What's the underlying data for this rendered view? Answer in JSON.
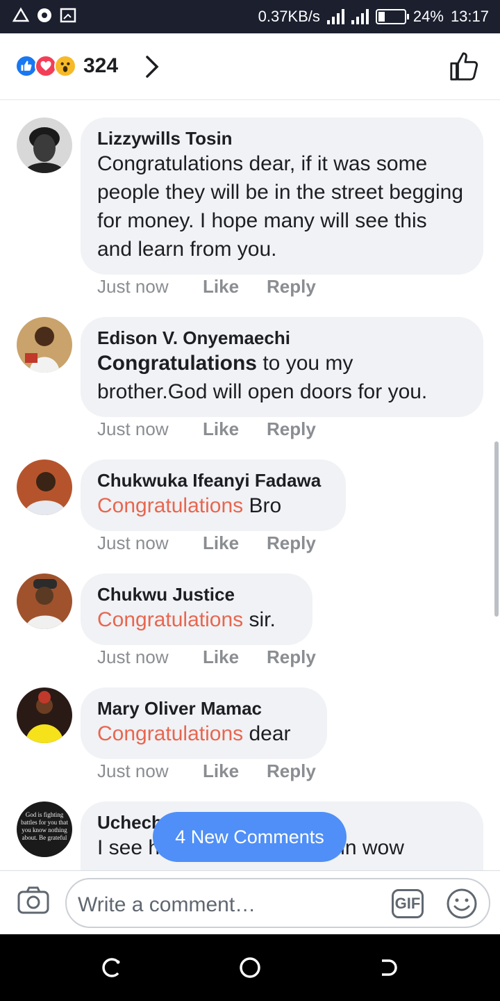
{
  "status_bar": {
    "net_speed": "0.37KB/s",
    "battery": "24%",
    "battery_level": 0.24,
    "time": "13:17"
  },
  "reactions": {
    "count": "324",
    "types": [
      "like",
      "love",
      "wow"
    ]
  },
  "comments": [
    {
      "author": "Lizzywills Tosin",
      "segments": [
        {
          "text": "Congratulations dear, if it was some people they will be in the street begging for money. I hope many will see this and learn from you.",
          "style": "plain"
        }
      ],
      "time": "Just now",
      "like": "Like",
      "reply": "Reply",
      "avatar": "woman-portrait-avatar"
    },
    {
      "author": "Edison V. Onyemaechi",
      "segments": [
        {
          "text": "Congratulations",
          "style": "bold"
        },
        {
          "text": " to you my brother.God will open doors for you.",
          "style": "plain"
        }
      ],
      "time": "Just now",
      "like": "Like",
      "reply": "Reply",
      "avatar": "child-avatar"
    },
    {
      "author": "Chukwuka Ifeanyi Fadawa",
      "segments": [
        {
          "text": "Congratulations",
          "style": "orange"
        },
        {
          "text": " Bro",
          "style": "plain"
        }
      ],
      "time": "Just now",
      "like": "Like",
      "reply": "Reply",
      "avatar": "man-avatar"
    },
    {
      "author": "Chukwu Justice",
      "segments": [
        {
          "text": "Congratulations",
          "style": "orange"
        },
        {
          "text": " sir.",
          "style": "plain"
        }
      ],
      "time": "Just now",
      "like": "Like",
      "reply": "Reply",
      "avatar": "man-cap-avatar"
    },
    {
      "author": "Mary Oliver Mamac",
      "segments": [
        {
          "text": "Congratulations",
          "style": "orange"
        },
        {
          "text": " dear",
          "style": "plain"
        }
      ],
      "time": "Just now",
      "like": "Like",
      "reply": "Reply",
      "avatar": "woman-yellow-avatar"
    },
    {
      "author": "Uchechukwu Nwadigo",
      "segments": [
        {
          "text": "I see him yesterday at doyin wow",
          "style": "plain"
        }
      ],
      "avatar": "quote-text-avatar",
      "avatar_text": "God is fighting battles for you that you know nothing about. Be grateful"
    }
  ],
  "new_comments_label": "4 New Comments",
  "composer": {
    "placeholder": "Write a comment…",
    "gif_label": "GIF"
  }
}
